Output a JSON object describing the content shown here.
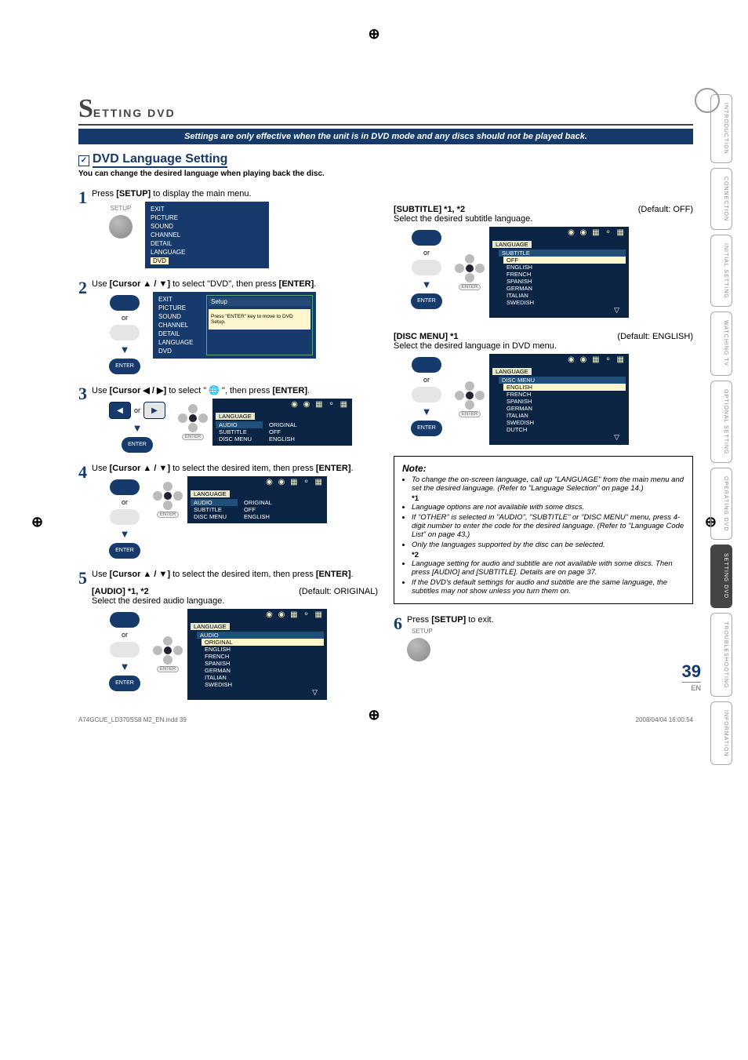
{
  "header": {
    "section_letter": "S",
    "section_rest": "ETTING   DVD"
  },
  "banner": "Settings are only effective when the unit is in DVD mode and any discs should not be played back.",
  "heading_check": "✓",
  "heading": "DVD Language Setting",
  "subtitle": "You can change the desired language when playing back the disc.",
  "step1": {
    "num": "1",
    "text_a": "Press ",
    "text_b": "[SETUP]",
    "text_c": " to display the main menu.",
    "remote_label": "SETUP",
    "menu": [
      "EXIT",
      "PICTURE",
      "SOUND",
      "CHANNEL",
      "DETAIL",
      "LANGUAGE",
      "DVD"
    ],
    "menu_hl": "DVD"
  },
  "step2": {
    "num": "2",
    "text_a": "Use ",
    "text_b": "[Cursor ▲ / ▼]",
    "text_c": " to select \"DVD\", then press ",
    "text_d": "[ENTER]",
    "text_e": ".",
    "or": "or",
    "enter": "ENTER",
    "setup_title": "Setup",
    "setup_msg": "Press \"ENTER\" key to move to DVD Setup.",
    "menu": [
      "EXIT",
      "PICTURE",
      "SOUND",
      "CHANNEL",
      "DETAIL",
      "LANGUAGE",
      "DVD"
    ]
  },
  "step3": {
    "num": "3",
    "text_a": "Use ",
    "text_b": "[Cursor ◀ / ▶]",
    "text_c": " to select \" 🌐 \", then press ",
    "text_d": "[ENTER]",
    "text_e": ".",
    "or": "or",
    "enter": "ENTER",
    "osd_header": "LANGUAGE",
    "rows_l": [
      "AUDIO",
      "SUBTITLE",
      "DISC MENU"
    ],
    "rows_r": [
      "ORIGINAL",
      "OFF",
      "ENGLISH"
    ]
  },
  "step4": {
    "num": "4",
    "text_a": "Use ",
    "text_b": "[Cursor ▲ / ▼]",
    "text_c": " to select the desired item, then press ",
    "text_d": "[ENTER]",
    "text_e": ".",
    "or": "or",
    "enter": "ENTER",
    "osd_header": "LANGUAGE",
    "rows_l": [
      "AUDIO",
      "SUBTITLE",
      "DISC MENU"
    ],
    "rows_r": [
      "ORIGINAL",
      "OFF",
      "ENGLISH"
    ]
  },
  "step5": {
    "num": "5",
    "text_a": "Use ",
    "text_b": "[Cursor ▲ / ▼]",
    "text_c": " to select the desired item, then press ",
    "text_d": "[ENTER]",
    "text_e": ".",
    "or": "or",
    "enter": "ENTER",
    "audio_head": "[AUDIO] *1, *2",
    "audio_def": "(Default: ORIGINAL)",
    "audio_sub": "Select the desired audio language.",
    "osd_header": "LANGUAGE",
    "sub_header": "AUDIO",
    "list": [
      "ORIGINAL",
      "ENGLISH",
      "FRENCH",
      "SPANISH",
      "GERMAN",
      "ITALIAN",
      "SWEDISH"
    ]
  },
  "right": {
    "subtitle_head": "[SUBTITLE] *1, *2",
    "subtitle_def": "(Default: OFF)",
    "subtitle_sub": "Select the desired subtitle language.",
    "or": "or",
    "enter": "ENTER",
    "osd_header": "LANGUAGE",
    "sub_header": "SUBTITLE",
    "subtitle_list": [
      "OFF",
      "ENGLISH",
      "FRENCH",
      "SPANISH",
      "GERMAN",
      "ITALIAN",
      "SWEDISH"
    ],
    "disc_head": "[DISC MENU] *1",
    "disc_def": "(Default: ENGLISH)",
    "disc_sub": "Select the desired language in DVD menu.",
    "disc_sub_header": "DISC MENU",
    "disc_list": [
      "ENGLISH",
      "FRENCH",
      "SPANISH",
      "GERMAN",
      "ITALIAN",
      "SWEDISH",
      "DUTCH"
    ]
  },
  "note": {
    "title": "Note:",
    "items": [
      "To change the on-screen language, call up \"LANGUAGE\" from the main menu and set the desired language. (Refer to \"Language Selection\" on page 14.)",
      "*1",
      "Language options are not available with some discs.",
      "If \"OTHER\" is selected in \"AUDIO\", \"SUBTITLE\" or \"DISC MENU\" menu, press 4-digit number to enter the code for the desired language. (Refer to \"Language Code List\" on page 43.)",
      "Only the languages supported by the disc can be selected.",
      "*2",
      "Language setting for audio and subtitle are not available with some discs. Then press [AUDIO] and [SUBTITLE]. Details are on page 37.",
      "If the DVD's default settings for audio and subtitle are the same language, the subtitles may not show unless you turn them on."
    ]
  },
  "step6": {
    "num": "6",
    "text_a": "Press ",
    "text_b": "[SETUP]",
    "text_c": " to exit.",
    "remote_label": "SETUP"
  },
  "tabs": [
    "INTRODUCTION",
    "CONNECTION",
    "INITIAL  SETTING",
    "WATCHING  TV",
    "OPTIONAL  SETTING",
    "OPERATING  DVD",
    "SETTING  DVD",
    "TROUBLESHOOTING",
    "INFORMATION"
  ],
  "active_tab": 6,
  "page_number": "39",
  "page_lang": "EN",
  "footer_left": "A74GCUE_LD370SS8 M2_EN.indd   39",
  "footer_right": "2008/04/04   16:00:54"
}
